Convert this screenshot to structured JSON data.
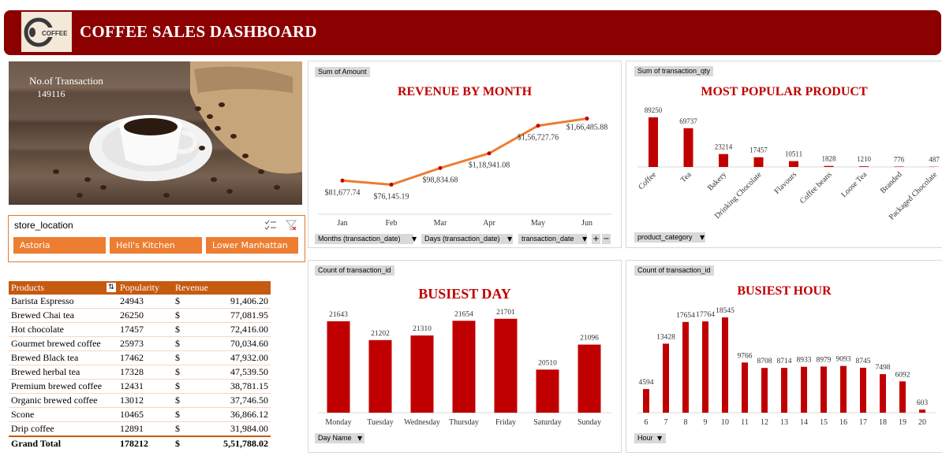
{
  "header": {
    "title": "COFFEE SALES DASHBOARD",
    "logo_text": "COFFEE"
  },
  "transactions": {
    "label": "No.of Transaction",
    "value": "149116"
  },
  "slicer": {
    "title": "store_location",
    "options": [
      "Astoria",
      "Hell's Kitchen",
      "Lower Manhattan"
    ]
  },
  "table": {
    "headers": [
      "Products",
      "Popularity",
      "Revenue"
    ],
    "rows": [
      {
        "product": "Barista Espresso",
        "popularity": "24943",
        "cur": "$",
        "revenue": "91,406.20"
      },
      {
        "product": "Brewed Chai tea",
        "popularity": "26250",
        "cur": "$",
        "revenue": "77,081.95"
      },
      {
        "product": "Hot chocolate",
        "popularity": "17457",
        "cur": "$",
        "revenue": "72,416.00"
      },
      {
        "product": "Gourmet brewed coffee",
        "popularity": "25973",
        "cur": "$",
        "revenue": "70,034.60"
      },
      {
        "product": "Brewed Black tea",
        "popularity": "17462",
        "cur": "$",
        "revenue": "47,932.00"
      },
      {
        "product": "Brewed herbal tea",
        "popularity": "17328",
        "cur": "$",
        "revenue": "47,539.50"
      },
      {
        "product": "Premium brewed coffee",
        "popularity": "12431",
        "cur": "$",
        "revenue": "38,781.15"
      },
      {
        "product": "Organic brewed coffee",
        "popularity": "13012",
        "cur": "$",
        "revenue": "37,746.50"
      },
      {
        "product": "Scone",
        "popularity": "10465",
        "cur": "$",
        "revenue": "36,866.12"
      },
      {
        "product": "Drip coffee",
        "popularity": "12891",
        "cur": "$",
        "revenue": "31,984.00"
      }
    ],
    "total": {
      "label": "Grand Total",
      "popularity": "178212",
      "cur": "$",
      "revenue": "5,51,788.02"
    }
  },
  "buttons": {
    "sum_amount": "Sum of Amount",
    "months": "Months (transaction_date)",
    "days": "Days (transaction_date)",
    "tdate": "transaction_date",
    "sum_qty": "Sum of transaction_qty",
    "product_category": "product_category",
    "count_id_day": "Count of transaction_id",
    "day_name": "Day Name",
    "count_id_hour": "Count of transaction_id",
    "hour": "Hour"
  },
  "chart_data": [
    {
      "type": "line",
      "title": "REVENUE BY MONTH",
      "categories": [
        "Jan",
        "Feb",
        "Mar",
        "Apr",
        "May",
        "Jun"
      ],
      "values": [
        81677.74,
        76145.19,
        98834.68,
        118941.08,
        156727.76,
        166485.88
      ],
      "labels": [
        "$81,677.74",
        "$76,145.19",
        "$98,834.68",
        "$1,18,941.08",
        "$1,56,727.76",
        "$1,66,485.88"
      ],
      "color": "#ed7d31",
      "marker_color": "#c00000"
    },
    {
      "type": "bar",
      "title": "MOST POPULAR PRODUCT",
      "categories": [
        "Coffee",
        "Tea",
        "Bakery",
        "Drinking Chocolate",
        "Flavours",
        "Coffee beans",
        "Loose Tea",
        "Branded",
        "Packaged Chocolate"
      ],
      "values": [
        89250,
        69737,
        23214,
        17457,
        10511,
        1828,
        1210,
        776,
        487
      ],
      "color": "#c00000"
    },
    {
      "type": "bar",
      "title": "BUSIEST DAY",
      "categories": [
        "Monday",
        "Tuesday",
        "Wednesday",
        "Thursday",
        "Friday",
        "Saturday",
        "Sunday"
      ],
      "values": [
        21643,
        21202,
        21310,
        21654,
        21701,
        20510,
        21096
      ],
      "ylim": [
        19500,
        22000
      ],
      "color": "#c00000"
    },
    {
      "type": "bar",
      "title": "BUSIEST HOUR",
      "categories": [
        "6",
        "7",
        "8",
        "9",
        "10",
        "11",
        "12",
        "13",
        "14",
        "15",
        "16",
        "17",
        "18",
        "19",
        "20"
      ],
      "values": [
        4594,
        13428,
        17654,
        17764,
        18545,
        9766,
        8708,
        8714,
        8933,
        8979,
        9093,
        8745,
        7498,
        6092,
        603
      ],
      "color": "#c00000"
    }
  ]
}
